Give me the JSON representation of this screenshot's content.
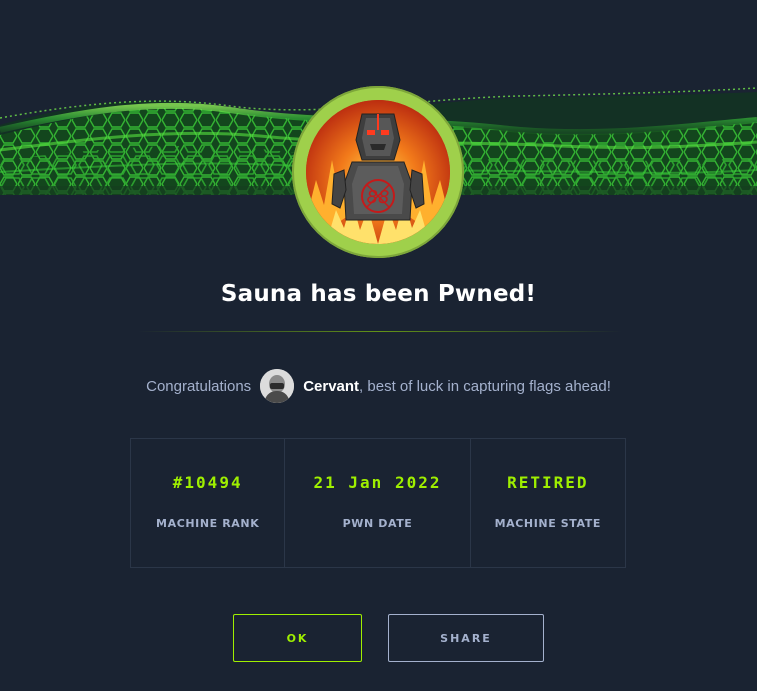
{
  "title": "Sauna has been Pwned!",
  "congrats": {
    "prefix": "Congratulations",
    "username": "Cervant",
    "suffix": ", best of luck in capturing flags ahead!"
  },
  "stats": [
    {
      "value": "#10494",
      "label": "MACHINE RANK"
    },
    {
      "value": "21 Jan 2022",
      "label": "PWN DATE"
    },
    {
      "value": "RETIRED",
      "label": "MACHINE STATE"
    }
  ],
  "buttons": {
    "ok": "OK",
    "share": "SHARE"
  },
  "icons": {
    "machine_avatar": "sauna-machine-avatar",
    "user_avatar": "user-avatar"
  },
  "colors": {
    "background": "#1a2332",
    "accent": "#9fef00",
    "ring": "#9fd04b",
    "muted": "#a4b1cd"
  }
}
